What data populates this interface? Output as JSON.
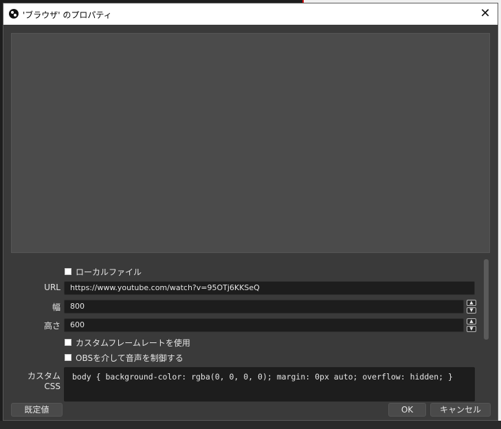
{
  "window": {
    "title": "'ブラウザ' のプロパティ"
  },
  "properties": {
    "local_file_label": "ローカルファイル",
    "url_label": "URL",
    "url_value": "https://www.youtube.com/watch?v=95OTj6KKSeQ",
    "width_label": "幅",
    "width_value": "800",
    "height_label": "高さ",
    "height_value": "600",
    "custom_framerate_label": "カスタムフレームレートを使用",
    "obs_audio_label": "OBSを介して音声を制御する",
    "custom_css_label": "カスタム CSS",
    "custom_css_value": "body { background-color: rgba(0, 0, 0, 0); margin: 0px auto; overflow: hidden; }"
  },
  "buttons": {
    "defaults_label": "既定値",
    "ok_label": "OK",
    "cancel_label": "キャンセル"
  },
  "colors": {
    "dialog_bg": "#3a3a3a",
    "preview_bg": "#4b4b4b",
    "field_bg": "#1d1d1d",
    "accent_red": "#d01010"
  }
}
